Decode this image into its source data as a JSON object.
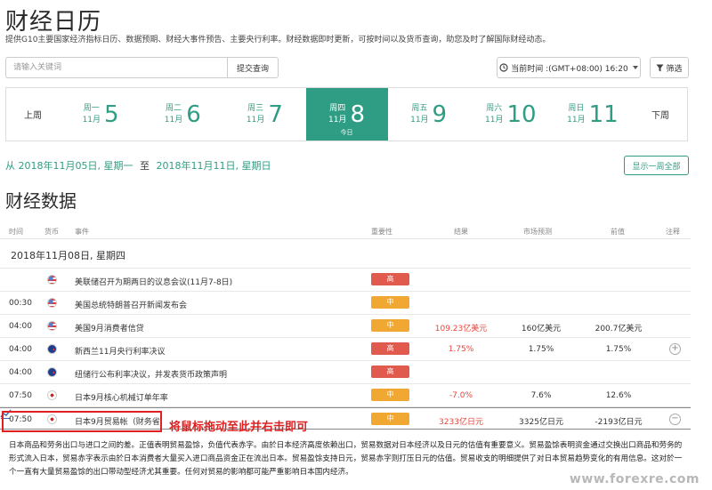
{
  "header": {
    "title": "财经日历",
    "subtitle": "提供G10主要国家经济指标日历、数据预期、财经大事件预告、主要央行利率。财经数据即时更新，可按时间以及货币查询，助您及时了解国际财经动态。"
  },
  "search": {
    "placeholder": "请输入关键词",
    "submit_label": "提交查询"
  },
  "toolbar": {
    "time_label": "当前时间 :(GMT+08:00) 16:20",
    "filter_label": "筛选"
  },
  "week": {
    "prev_label": "上周",
    "next_label": "下周",
    "today_label": "今日",
    "days": [
      {
        "weekday": "周一",
        "month": "11月",
        "day": "5"
      },
      {
        "weekday": "周二",
        "month": "11月",
        "day": "6"
      },
      {
        "weekday": "周三",
        "month": "11月",
        "day": "7"
      },
      {
        "weekday": "周四",
        "month": "11月",
        "day": "8"
      },
      {
        "weekday": "周五",
        "month": "11月",
        "day": "9"
      },
      {
        "weekday": "周六",
        "month": "11月",
        "day": "10"
      },
      {
        "weekday": "周日",
        "month": "11月",
        "day": "11"
      }
    ]
  },
  "range": {
    "from_prefix": "从",
    "from": "2018年11月05日, 星期一",
    "to_word": "至",
    "to": "2018年11月11日, 星期日",
    "show_week_label": "显示一周全部"
  },
  "section_title": "财经数据",
  "table": {
    "headers": {
      "time": "时间",
      "currency": "货币",
      "event": "事件",
      "importance": "重要性",
      "actual": "结果",
      "forecast": "市场预测",
      "previous": "前值",
      "note": "注释"
    },
    "date_group": "2018年11月08日, 星期四",
    "rows": [
      {
        "time": "",
        "flag": "us",
        "event": "美联储召开为期两日的议息会议(11月7-8日)",
        "importance": "高",
        "actual": "",
        "forecast": "",
        "previous": "",
        "action": ""
      },
      {
        "time": "00:30",
        "flag": "us",
        "event": "美国总统特朗普召开新闻发布会",
        "importance": "中",
        "actual": "",
        "forecast": "",
        "previous": "",
        "action": ""
      },
      {
        "time": "04:00",
        "flag": "us",
        "event": "美国9月消费者信贷",
        "importance": "中",
        "actual": "109.23亿美元",
        "forecast": "160亿美元",
        "previous": "200.7亿美元",
        "action": ""
      },
      {
        "time": "04:00",
        "flag": "nz",
        "event": "新西兰11月央行利率决议",
        "importance": "高",
        "actual": "1.75%",
        "forecast": "1.75%",
        "previous": "1.75%",
        "action": "+"
      },
      {
        "time": "04:00",
        "flag": "nz",
        "event": "纽储行公布利率决议，并发表货币政策声明",
        "importance": "高",
        "actual": "",
        "forecast": "",
        "previous": "",
        "action": ""
      },
      {
        "time": "07:50",
        "flag": "jp",
        "event": "日本9月核心机械订单年率",
        "importance": "中",
        "actual": "-7.0%",
        "forecast": "7.6%",
        "previous": "12.6%",
        "action": ""
      },
      {
        "time": "07:50",
        "flag": "jp",
        "event": "日本9月贸易帐（财务省",
        "importance": "中",
        "actual": "3233亿日元",
        "forecast": "3325亿日元",
        "previous": "-2193亿日元",
        "action": "−"
      }
    ]
  },
  "annotation": "将鼠标拖动至此并右击即可",
  "detail_text": "日本商品和劳务出口与进口之间的差。正值表明贸易盈馀，负值代表赤字。由於日本经济高度依赖出口，贸易数据对日本经济以及日元的估值有重要意义。贸易盈馀表明资金通过交换出口商品和劳务的形式流入日本，贸易赤字表示由於日本消费者大量买入进口商品资金正在流出日本。贸易盈馀支持日元，贸易赤字则打压日元的估值。贸易收支的明细提供了对日本贸易趋势变化的有用信息。这对於一个一直有大量贸易盈馀的出口带动型经济尤其重要。任何对贸易的影响都可能严重影响日本国内经济。",
  "watermark": "www.forexre.com",
  "colors": {
    "accent": "#2f9d83",
    "importance_high": "#e05a4e",
    "importance_mid": "#f0a832",
    "actual_value": "#e8453c",
    "annotation": "#e02020"
  }
}
